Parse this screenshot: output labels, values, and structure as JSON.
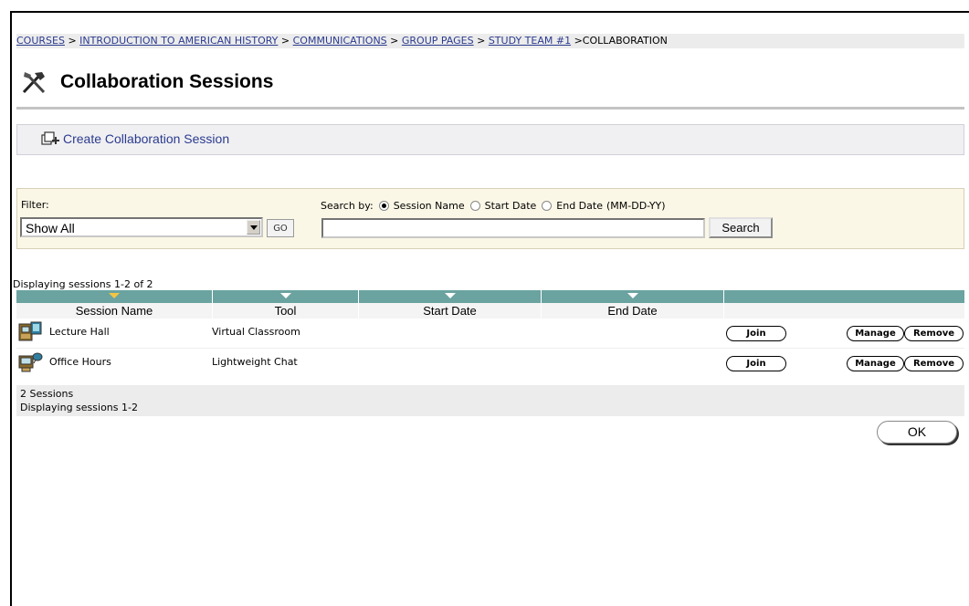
{
  "breadcrumb": {
    "items": [
      "COURSES",
      "INTRODUCTION TO AMERICAN HISTORY",
      "COMMUNICATIONS",
      "GROUP PAGES",
      "STUDY TEAM #1"
    ],
    "separator": ">",
    "current": "COLLABORATION"
  },
  "page": {
    "title": "Collaboration Sessions",
    "title_icon": "tools-icon"
  },
  "actions": {
    "create_label": "Create Collaboration Session",
    "create_icon": "create-session-icon"
  },
  "filter": {
    "label": "Filter:",
    "selected": "Show All",
    "go_label": "GO",
    "search_by_label": "Search by:",
    "options": [
      "Session Name",
      "Start Date",
      "End Date"
    ],
    "date_format": "(MM-DD-YY)",
    "selected_option": "Session Name",
    "search_value": "",
    "search_label": "Search"
  },
  "list": {
    "displaying_top": "Displaying sessions 1-2 of 2",
    "columns": [
      "Session Name",
      "Tool",
      "Start Date",
      "End Date"
    ],
    "sorted_column": "Session Name",
    "rows": [
      {
        "name": "Lecture Hall",
        "tool": "Virtual Classroom",
        "icon": "virtual-classroom-icon",
        "start": "",
        "end": ""
      },
      {
        "name": "Office Hours",
        "tool": "Lightweight Chat",
        "icon": "lightweight-chat-icon",
        "start": "",
        "end": ""
      }
    ],
    "join_label": "Join",
    "manage_label": "Manage",
    "remove_label": "Remove",
    "count_text": "2 Sessions",
    "displaying_bottom": "Displaying sessions 1-2"
  },
  "ok_label": "OK",
  "colors": {
    "link": "#2b3b8f",
    "header_bar": "#6aa3a0",
    "filter_bg": "#fbf7e6",
    "sort_arrow": "#f4c542"
  }
}
